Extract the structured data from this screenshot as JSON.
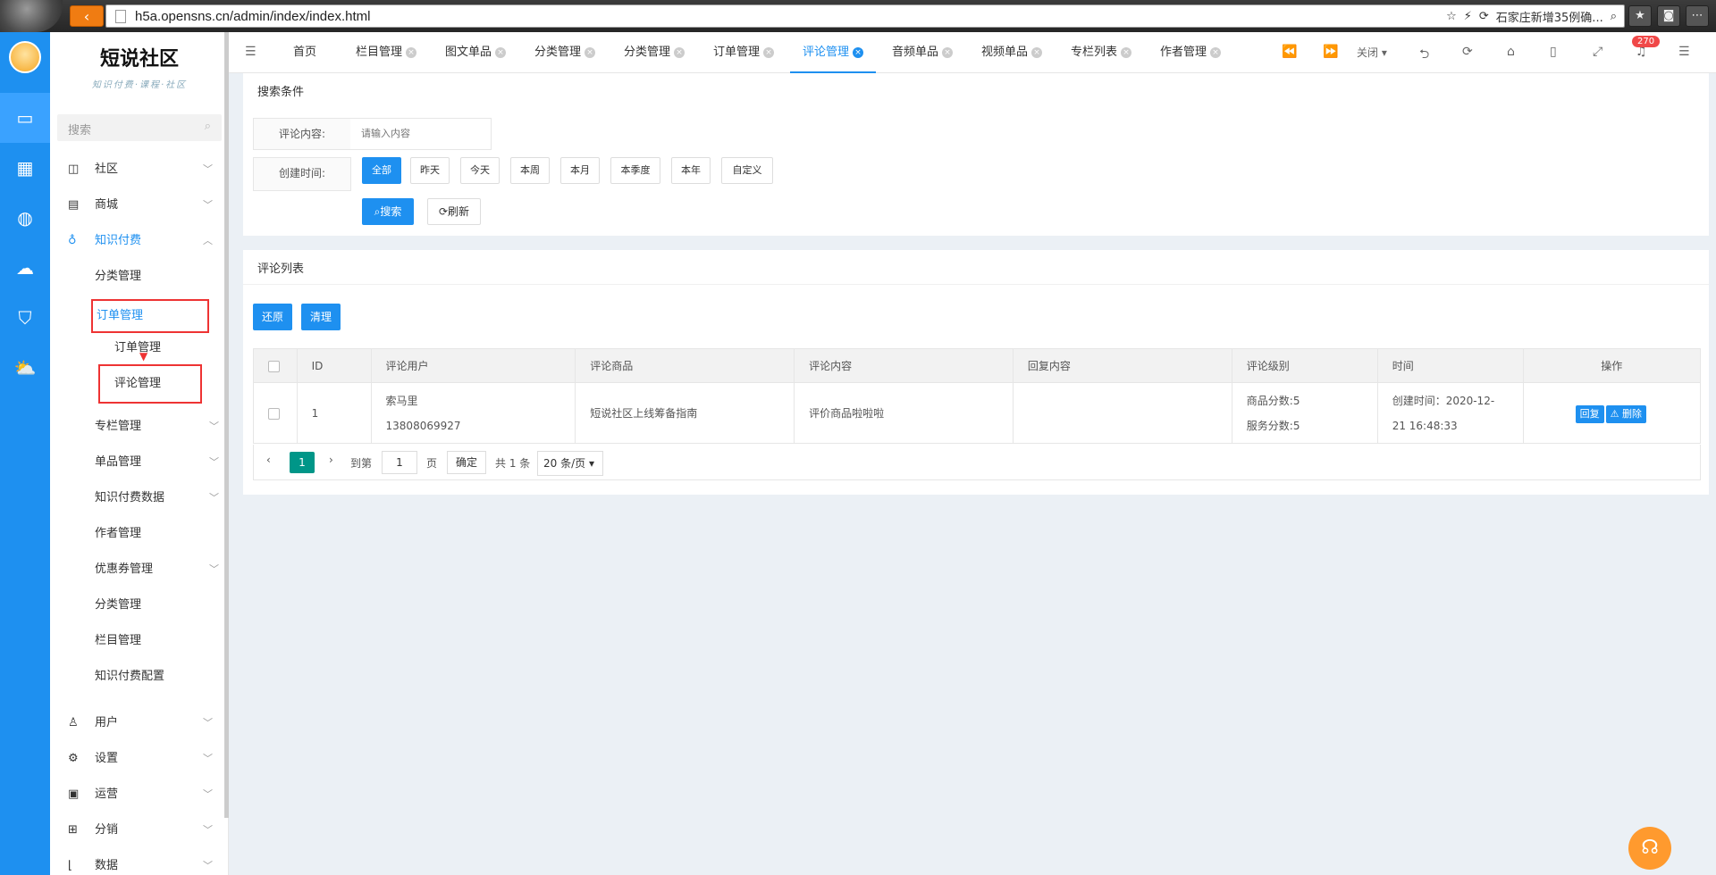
{
  "browser": {
    "url": "h5a.opensns.cn/admin/index/index.html",
    "search_hint": "石家庄新增35例确..."
  },
  "sidebar": {
    "logo_title": "短说社区",
    "logo_sub": "知识付费·课程·社区",
    "search_placeholder": "搜索",
    "menus": [
      {
        "label": "社区",
        "icon": "comment-icon"
      },
      {
        "label": "商城",
        "icon": "shop-icon"
      },
      {
        "label": "知识付费",
        "icon": "bulb-icon"
      }
    ],
    "knowledge_sub": {
      "category": "分类管理",
      "order": "订单管理",
      "order_child": "订单管理",
      "comment_child": "评论管理",
      "column": "专栏管理",
      "single": "单品管理",
      "data": "知识付费数据",
      "author": "作者管理",
      "coupon": "优惠券管理",
      "category2": "分类管理",
      "column2": "栏目管理",
      "config": "知识付费配置"
    },
    "bottom_menus": [
      {
        "label": "用户",
        "icon": "user-icon"
      },
      {
        "label": "设置",
        "icon": "gear-icon"
      },
      {
        "label": "运营",
        "icon": "monitor-icon"
      },
      {
        "label": "分销",
        "icon": "org-icon"
      },
      {
        "label": "数据",
        "icon": "chart-icon"
      }
    ]
  },
  "tabs": [
    "首页",
    "栏目管理",
    "图文单品",
    "分类管理",
    "分类管理",
    "订单管理",
    "评论管理",
    "音频单品",
    "视频单品",
    "专栏列表",
    "作者管理"
  ],
  "tab_tools": {
    "close": "关闭",
    "badge": "270"
  },
  "search_panel": {
    "title": "搜索条件",
    "content_label": "评论内容:",
    "content_placeholder": "请输入内容",
    "time_label": "创建时间:",
    "chips": [
      "全部",
      "昨天",
      "今天",
      "本周",
      "本月",
      "本季度",
      "本年",
      "自定义"
    ],
    "search_btn": "搜索",
    "refresh_btn": "刷新"
  },
  "list_panel": {
    "title": "评论列表",
    "restore_btn": "还原",
    "clear_btn": "清理",
    "columns": [
      "ID",
      "评论用户",
      "评论商品",
      "评论内容",
      "回复内容",
      "评论级别",
      "时间",
      "操作"
    ],
    "row": {
      "id": "1",
      "user_name": "索马里",
      "user_phone": "13808069927",
      "product": "短说社区上线筹备指南",
      "content": "评价商品啦啦啦",
      "reply": "",
      "score_goods": "商品分数:5",
      "score_service": "服务分数:5",
      "time_line1": "创建时间：2020-12-",
      "time_line2": "21 16:48:33",
      "reply_btn": "回复",
      "delete_btn": "删除"
    },
    "pager": {
      "current": "1",
      "goto_label": "到第",
      "page_input": "1",
      "page_unit": "页",
      "confirm": "确定",
      "total": "共 1 条",
      "per_page": "20 条/页"
    }
  }
}
